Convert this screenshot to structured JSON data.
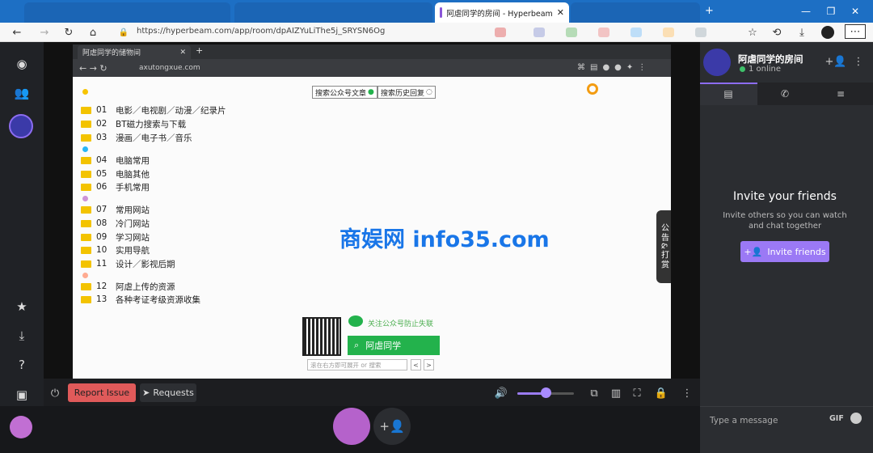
{
  "browser": {
    "tab_title": "阿虐同学的房间 - Hyperbeam",
    "tab_close": "✕",
    "new_tab": "+",
    "url": "https://hyperbeam.com/app/room/dpAIZYuLiThe5j_SRYSN6Og"
  },
  "inner_browser": {
    "tab_title": "阿虐同学的储物间",
    "url": "axutongxue.com"
  },
  "page": {
    "search_articles": "搜索公众号文章",
    "search_history": "搜索历史回复",
    "categories": [
      {
        "num": "01",
        "label": "电影／电视剧／动漫／纪录片"
      },
      {
        "num": "02",
        "label": "BT磁力搜索与下载"
      },
      {
        "num": "03",
        "label": "漫画／电子书／音乐"
      },
      {
        "num": "04",
        "label": "电脑常用"
      },
      {
        "num": "05",
        "label": "电脑其他"
      },
      {
        "num": "06",
        "label": "手机常用"
      },
      {
        "num": "07",
        "label": "常用网站"
      },
      {
        "num": "08",
        "label": "冷门网站"
      },
      {
        "num": "09",
        "label": "学习网站"
      },
      {
        "num": "10",
        "label": "实用导航"
      },
      {
        "num": "11",
        "label": "设计／影视后期"
      },
      {
        "num": "12",
        "label": "阿虐上传的资源"
      },
      {
        "num": "13",
        "label": "各种考证考级资源收集"
      }
    ],
    "follow_text": "关注公众号防止失联",
    "wechat_name": "阿虐同学",
    "search_placeholder": "滚在右方即可展开 or 搜索",
    "prev": "<",
    "next": ">",
    "side_tab": "公告&打赏"
  },
  "watermark": "商娱网 info35.com",
  "controls": {
    "report_issue": "Report Issue",
    "requests": "Requests"
  },
  "room": {
    "title": "阿虐同学的房间",
    "online": "1 online",
    "invite_title": "Invite your friends",
    "invite_sub": "Invite others so you can watch and chat together",
    "invite_button": "Invite friends",
    "message_placeholder": "Type a message",
    "gif": "GIF"
  },
  "volume": 0.5,
  "colors": {
    "accent": "#9b79f5",
    "report": "#e05a5a",
    "wechat": "#23b24c",
    "watermark": "#1976e8"
  }
}
